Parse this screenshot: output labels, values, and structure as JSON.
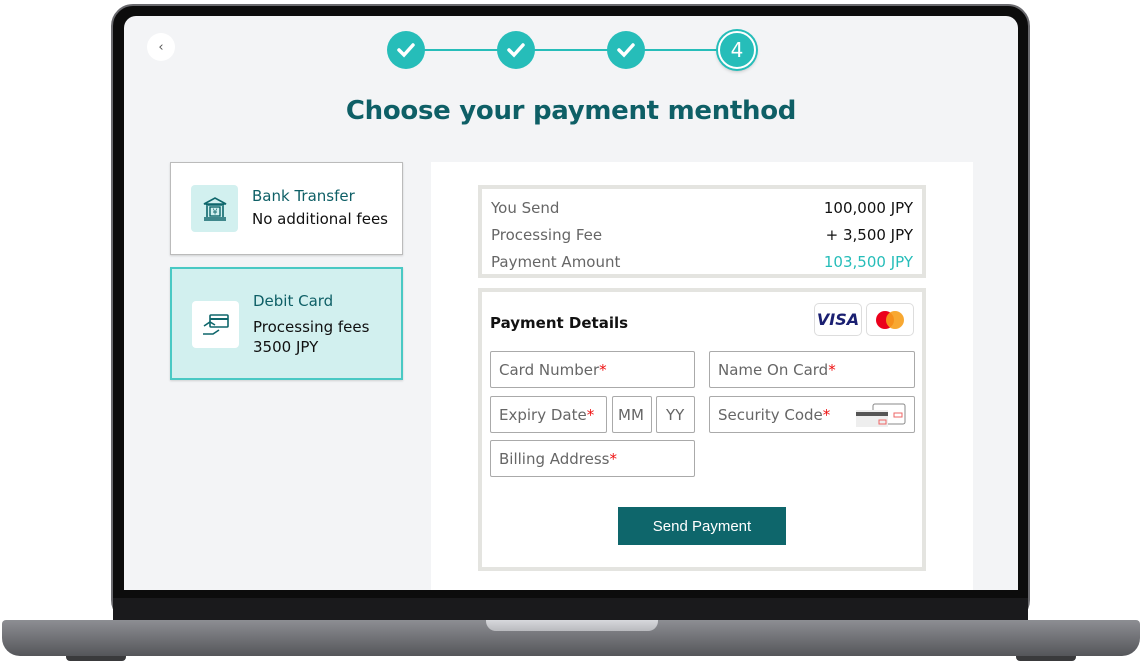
{
  "header": {
    "back_icon": "chevron-left-icon",
    "steps": [
      {
        "state": "complete"
      },
      {
        "state": "complete"
      },
      {
        "state": "complete"
      },
      {
        "state": "current",
        "label": "4"
      }
    ],
    "title": "Choose your payment menthod"
  },
  "methods": [
    {
      "title": "Bank Transfer",
      "desc": "No additional fees",
      "icon": "bank-yen-icon",
      "selected": false
    },
    {
      "title": "Debit Card",
      "desc": "Processing fees",
      "desc2": "3500 JPY",
      "icon": "card-hand-icon",
      "selected": true
    }
  ],
  "summary": {
    "rows": [
      {
        "label": "You Send",
        "value": "100,000 JPY"
      },
      {
        "label": "Processing Fee",
        "value": "+ 3,500 JPY"
      },
      {
        "label": "Payment Amount",
        "value": "103,500 JPY"
      }
    ]
  },
  "details": {
    "title": "Payment Details",
    "brands": [
      "VISA",
      "mastercard"
    ],
    "fields": {
      "card_number": "Card Number",
      "name_on_card": "Name On Card",
      "expiry": "Expiry Date",
      "mm": "MM",
      "yy": "YY",
      "security": "Security Code",
      "billing": "Billing Address",
      "required_mark": "*"
    },
    "send_label": "Send Payment"
  },
  "colors": {
    "accent": "#26bdb9",
    "title": "#0e5f66",
    "button": "#0e666b",
    "amount": "#26bdb9"
  }
}
